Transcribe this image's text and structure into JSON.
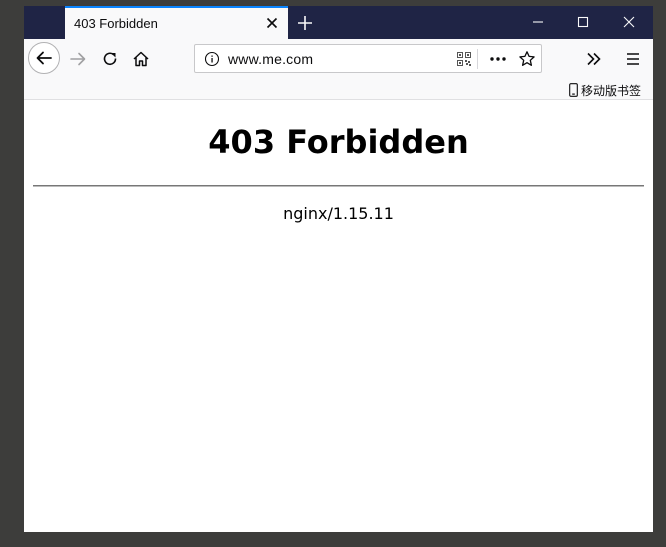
{
  "browser": {
    "tab": {
      "title": "403 Forbidden"
    },
    "address_bar": {
      "url": "www.me.com"
    },
    "bookmarks_bar": {
      "mobile_bookmarks_label": "移动版书签"
    },
    "icons": [
      "close-icon",
      "plus-icon",
      "minimize-icon",
      "maximize-icon",
      "back-arrow-icon",
      "forward-arrow-icon",
      "reload-icon",
      "home-icon",
      "info-icon",
      "qr-code-icon",
      "more-icon",
      "star-icon",
      "overflow-chevrons-icon",
      "hamburger-menu-icon",
      "phone-icon"
    ]
  },
  "page": {
    "heading": "403 Forbidden",
    "server": "nginx/1.15.11"
  }
}
